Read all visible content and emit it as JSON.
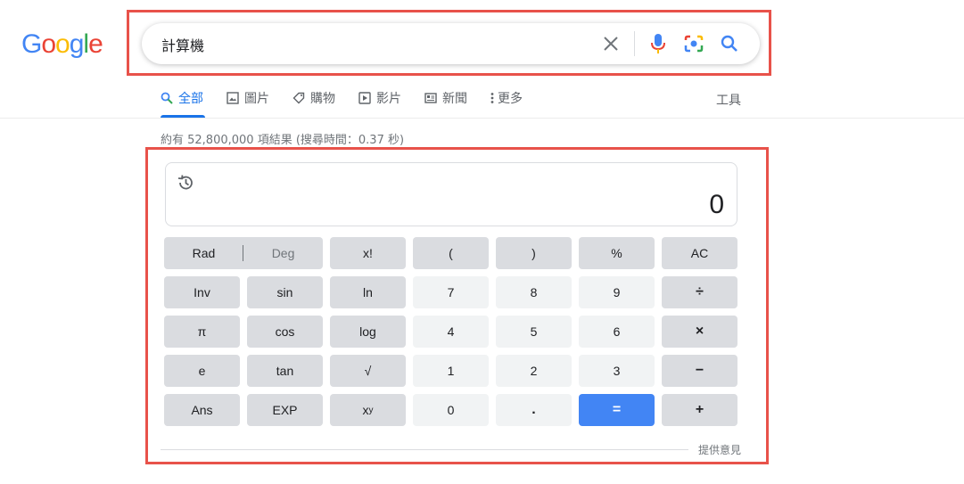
{
  "logo": {
    "letters": [
      "G",
      "o",
      "o",
      "g",
      "l",
      "e"
    ],
    "colors": [
      "#4285f4",
      "#ea4335",
      "#fbbc05",
      "#4285f4",
      "#34a853",
      "#ea4335"
    ]
  },
  "search": {
    "query": "計算機"
  },
  "tabs": [
    {
      "label": "全部",
      "icon": "search-icon"
    },
    {
      "label": "圖片",
      "icon": "image-icon"
    },
    {
      "label": "購物",
      "icon": "tag-icon"
    },
    {
      "label": "影片",
      "icon": "play-icon"
    },
    {
      "label": "新聞",
      "icon": "news-icon"
    },
    {
      "label": "更多",
      "icon": "more-vert-icon"
    }
  ],
  "tools_label": "工具",
  "result_stats": "約有 52,800,000 項結果 (搜尋時間：0.37 秒)",
  "calculator": {
    "display_value": "0",
    "rad_label": "Rad",
    "deg_label": "Deg",
    "keys": {
      "fact": "x!",
      "lparen": "(",
      "rparen": ")",
      "percent": "%",
      "ac": "AC",
      "inv": "Inv",
      "sin": "sin",
      "ln": "ln",
      "seven": "7",
      "eight": "8",
      "nine": "9",
      "divide": "÷",
      "pi": "π",
      "cos": "cos",
      "log": "log",
      "four": "4",
      "five": "5",
      "six": "6",
      "multiply": "×",
      "e": "e",
      "tan": "tan",
      "sqrt": "√",
      "one": "1",
      "two": "2",
      "three": "3",
      "minus": "−",
      "ans": "Ans",
      "exp": "EXP",
      "pow_base": "x",
      "pow_exp": "y",
      "zero": "0",
      "dot": ".",
      "equals": "=",
      "plus": "+"
    }
  },
  "feedback_label": "提供意見",
  "colors": {
    "accent": "#1a73e8",
    "equals_button": "#4285f4",
    "highlight_frame": "#e8524a"
  }
}
